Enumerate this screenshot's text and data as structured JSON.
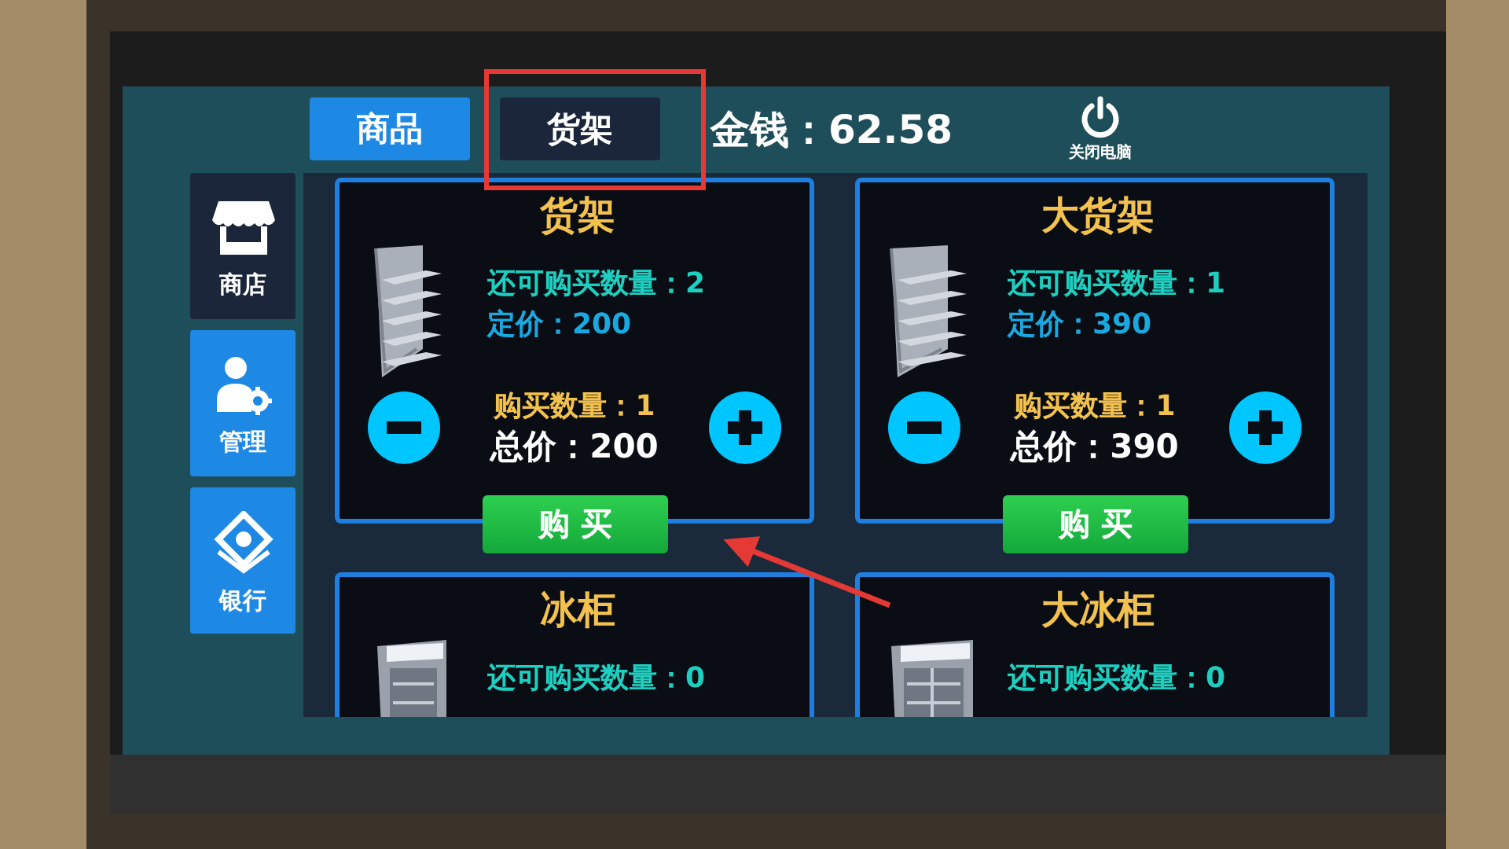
{
  "top_tabs": [
    {
      "label": "商品",
      "selected": false
    },
    {
      "label": "货架",
      "selected": true
    }
  ],
  "money": "金钱：62.58",
  "power_button": {
    "label": "关闭电脑"
  },
  "sidebar": {
    "items": [
      {
        "label": "商店",
        "selected": true,
        "kind": "store"
      },
      {
        "label": "管理",
        "selected": false,
        "kind": "manage"
      },
      {
        "label": "银行",
        "selected": false,
        "kind": "bank"
      }
    ]
  },
  "products": [
    {
      "kind": "shelf",
      "name": "货架",
      "remaining": "还可购买数量：2",
      "price": "定价：200",
      "quantity": "购买数量：1",
      "total": "总价：200",
      "buy_label": "购 买"
    },
    {
      "kind": "big_shelf",
      "name": "大货架",
      "remaining": "还可购买数量：1",
      "price": "定价：390",
      "quantity": "购买数量：1",
      "total": "总价：390",
      "buy_label": "购 买"
    },
    {
      "kind": "fridge",
      "name": "冰柜",
      "remaining": "还可购买数量：0"
    },
    {
      "kind": "big_fridge",
      "name": "大冰柜",
      "remaining": "还可购买数量：0"
    }
  ],
  "annotations": {
    "highlight_box": true,
    "pointer_arrow": true
  }
}
